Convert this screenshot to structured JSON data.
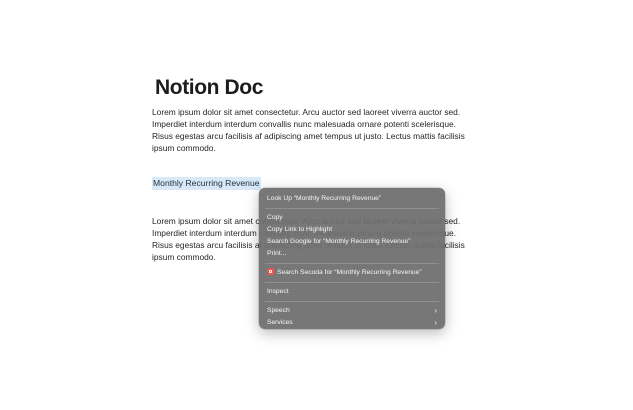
{
  "document": {
    "title": "Notion Doc",
    "paragraph_1": "Lorem ipsum dolor sit amet consectetur. Arcu auctor sed laoreet viverra auctor sed. Imperdiet interdum interdum convallis nunc malesuada ornare potenti scelerisque. Risus egestas arcu facilisis af adipiscing amet tempus ut justo. Lectus mattis facilisis ipsum commodo.",
    "highlighted_text": "Monthly Recurring Revenue",
    "paragraph_2": "Lorem ipsum dolor sit amet consectetur. Arcu auctor sed laoreet viverra auctor sed. Imperdiet interdum interdum convallis nunc malesuada ornare potenti scelerisque. Risus egestas arcu facilisis af adipiscing amet tempus ut justo. Lectus mattis facilisis ipsum commodo."
  },
  "context_menu": {
    "look_up": "Look Up “Monthly Recurring Revenue”",
    "copy": "Copy",
    "copy_link_highlight": "Copy Link to Highlight",
    "search_google": "Search Google for “Monthly Recurring Revenue”",
    "print": "Print...",
    "search_secoda": "Search Secoda for “Monthly Recurring Revenue”",
    "inspect": "Inspect",
    "speech": "Speech",
    "services": "Services",
    "secoda_icon": "secoda-app-icon",
    "submenu_icon": "chevron-right-icon"
  }
}
